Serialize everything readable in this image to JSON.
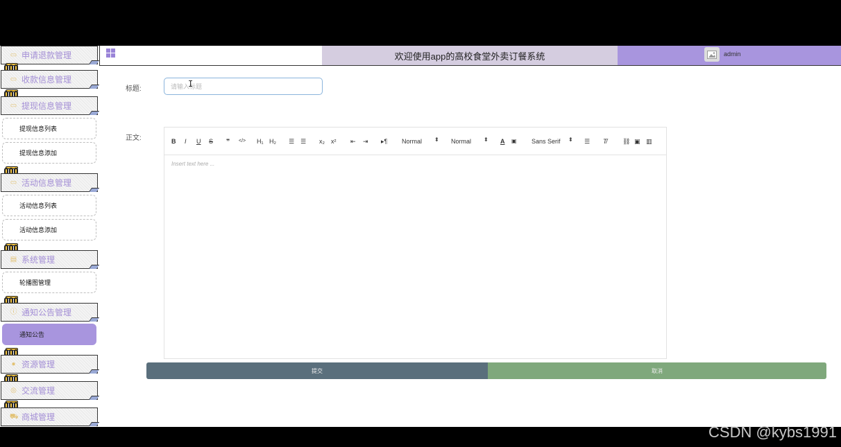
{
  "header": {
    "title": "欢迎使用app的高校食堂外卖订餐系统",
    "username": "admin",
    "accent_color": "#a895de",
    "title_bg_color": "#d5cde0"
  },
  "sidebar": {
    "menus": {
      "refund": {
        "label": "申请退款管理",
        "icon": "calendar-icon"
      },
      "payment": {
        "label": "收款信息管理",
        "icon": "calendar-icon"
      },
      "withdraw": {
        "label": "提现信息管理",
        "icon": "calendar-icon"
      },
      "activity": {
        "label": "活动信息管理",
        "icon": "calendar-icon"
      },
      "system": {
        "label": "系统管理",
        "icon": "list-icon"
      },
      "notice": {
        "label": "通知公告管理",
        "icon": "info-icon"
      },
      "resource": {
        "label": "资源管理",
        "icon": "location-icon"
      },
      "chat": {
        "label": "交流管理",
        "icon": "chat-icon"
      },
      "shop": {
        "label": "商城管理",
        "icon": "cart-icon"
      }
    },
    "subs": {
      "withdraw_list": "提现信息列表",
      "withdraw_add": "提现信息添加",
      "activity_list": "活动信息列表",
      "activity_add": "活动信息添加",
      "carousel": "轮播图管理",
      "notice": "通知公告"
    }
  },
  "form": {
    "title_label": "标题:",
    "title_placeholder": "请输入标题",
    "content_label": "正文:",
    "editor_placeholder": "Insert text here ...",
    "toolbar": {
      "bold": "B",
      "italic": "I",
      "underline": "U",
      "strike": "S",
      "quote": "❞",
      "code": "</>",
      "h1": "H₁",
      "h2": "H₂",
      "ordered_list": "☰",
      "bullet_list": "☰",
      "sub": "x₂",
      "sup": "x²",
      "outdent": "⇤",
      "indent": "⇥",
      "direction": "▸¶",
      "size_value": "Normal",
      "header_value": "Normal",
      "font_value": "Sans Serif"
    },
    "submit_label": "提交",
    "cancel_label": "取消",
    "submit_color": "#5a6f7c",
    "cancel_color": "#7fa87c"
  },
  "watermark": "CSDN @kybs1991"
}
